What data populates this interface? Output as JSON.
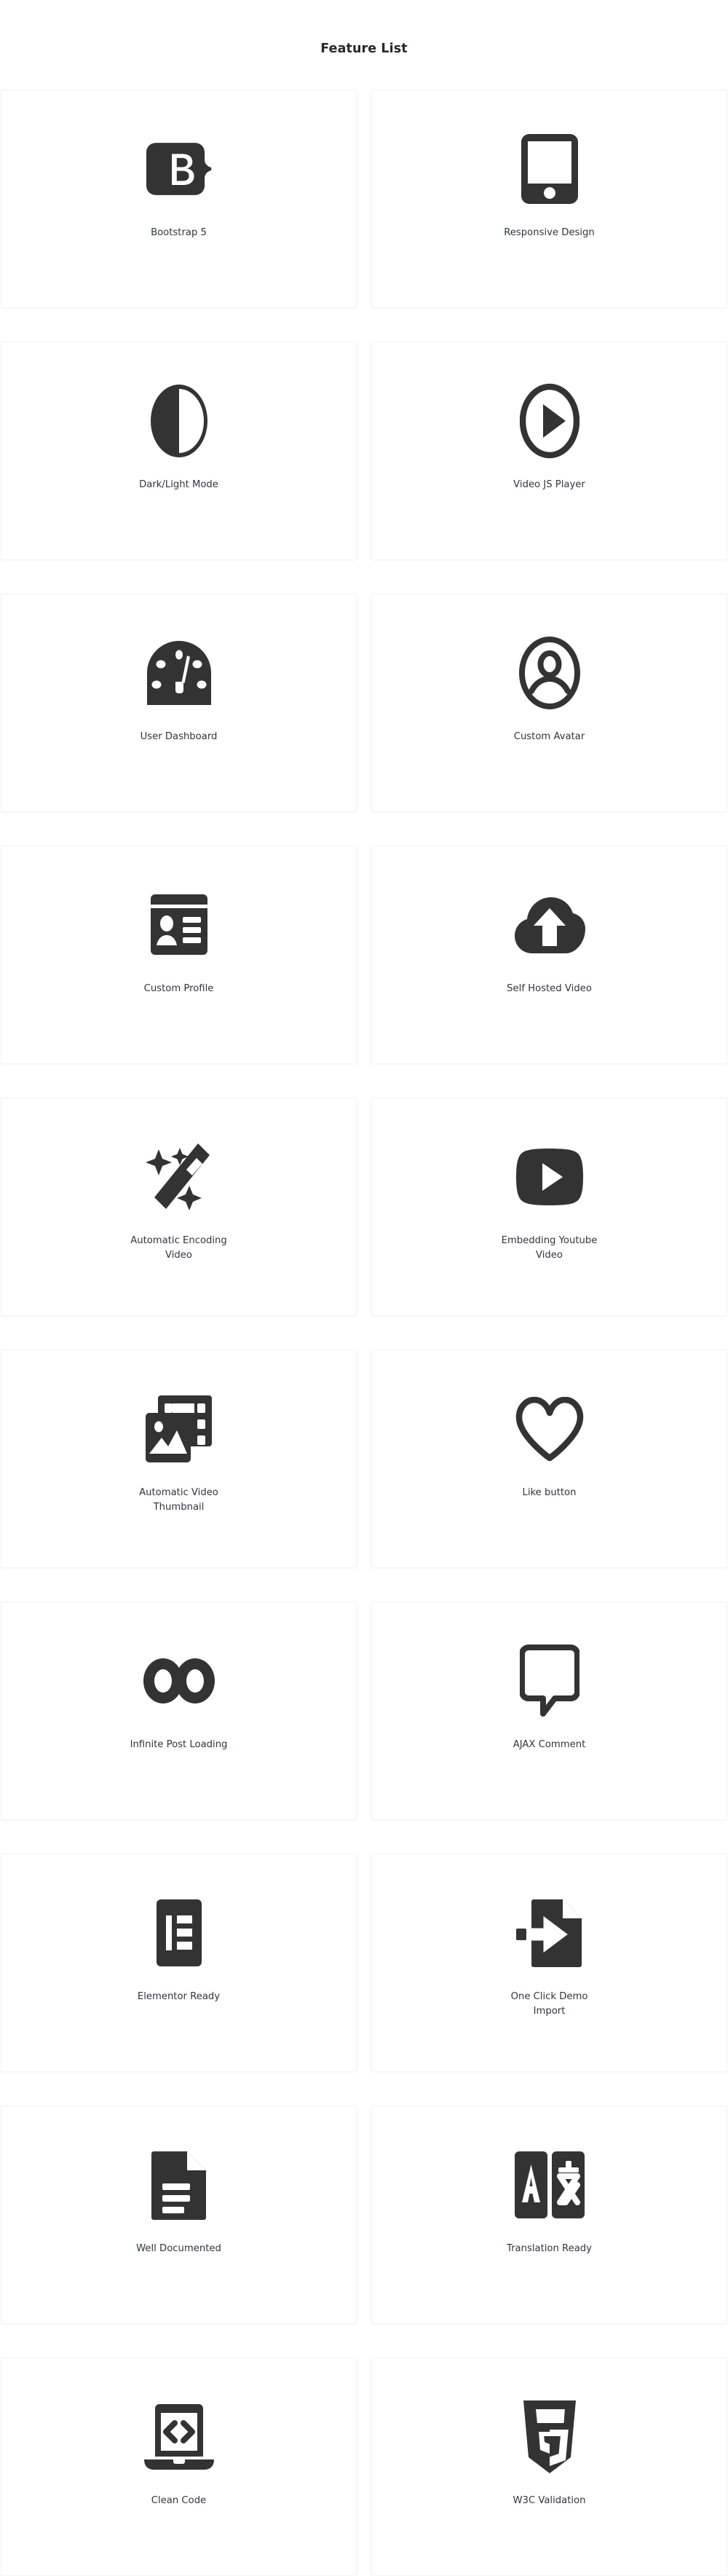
{
  "page": {
    "title": "Feature List",
    "background_color": "#ffffff",
    "icon_color": "#333333",
    "label_color": "#2f3640",
    "card_border_color": "#f2f2f3"
  },
  "features": [
    {
      "id": "bootstrap-5",
      "label": "Bootstrap 5",
      "icon": "bootstrap-icon"
    },
    {
      "id": "responsive-design",
      "label": "Responsive Design",
      "icon": "tablet-icon"
    },
    {
      "id": "dark-light-mode",
      "label": "Dark/Light Mode",
      "icon": "half-circle-icon"
    },
    {
      "id": "video-js-player",
      "label": "Video JS Player",
      "icon": "play-circle-icon"
    },
    {
      "id": "user-dashboard",
      "label": "User Dashboard",
      "icon": "gauge-icon"
    },
    {
      "id": "custom-avatar",
      "label": "Custom Avatar",
      "icon": "user-circle-icon"
    },
    {
      "id": "custom-profile",
      "label": "Custom Profile",
      "icon": "id-card-icon"
    },
    {
      "id": "self-hosted-video",
      "label": "Self Hosted Video",
      "icon": "cloud-upload-icon"
    },
    {
      "id": "automatic-encoding-video",
      "label": "Automatic Encoding\nVideo",
      "icon": "magic-wand-icon"
    },
    {
      "id": "embedding-youtube-video",
      "label": "Embedding Youtube\nVideo",
      "icon": "youtube-icon"
    },
    {
      "id": "automatic-video-thumbnail",
      "label": "Automatic Video\nThumbnail",
      "icon": "image-film-icon"
    },
    {
      "id": "like-button",
      "label": "Like button",
      "icon": "heart-icon"
    },
    {
      "id": "infinite-post-loading",
      "label": "Infinite Post Loading",
      "icon": "infinity-icon"
    },
    {
      "id": "ajax-comment",
      "label": "AJAX Comment",
      "icon": "comment-icon"
    },
    {
      "id": "elementor-ready",
      "label": "Elementor Ready",
      "icon": "elementor-icon"
    },
    {
      "id": "one-click-demo-import",
      "label": "One Click Demo\nImport",
      "icon": "file-import-icon"
    },
    {
      "id": "well-documented",
      "label": "Well Documented",
      "icon": "file-lines-icon"
    },
    {
      "id": "translation-ready",
      "label": "Translation Ready",
      "icon": "translate-icon"
    },
    {
      "id": "clean-code",
      "label": "Clean Code",
      "icon": "laptop-code-icon"
    },
    {
      "id": "w3c-validation",
      "label": "W3C Validation",
      "icon": "html5-shield-icon"
    }
  ]
}
